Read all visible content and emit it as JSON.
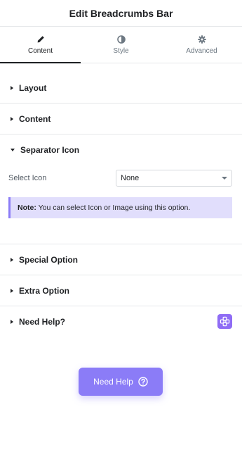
{
  "header": {
    "title": "Edit Breadcrumbs Bar"
  },
  "tabs": [
    {
      "label": "Content",
      "icon": "pencil-icon",
      "active": true
    },
    {
      "label": "Style",
      "icon": "contrast-icon",
      "active": false
    },
    {
      "label": "Advanced",
      "icon": "gear-icon",
      "active": false
    }
  ],
  "sections": {
    "layout": {
      "title": "Layout"
    },
    "content": {
      "title": "Content"
    },
    "separator": {
      "title": "Separator Icon",
      "select_label": "Select Icon",
      "select_value": "None",
      "note_bold": "Note:",
      "note_text": " You can select Icon or Image using this option."
    },
    "special": {
      "title": "Special Option"
    },
    "extra": {
      "title": "Extra Option"
    },
    "help": {
      "title": "Need Help?",
      "badge_icon": "plugin-logo-icon"
    }
  },
  "need_help_button": {
    "label": "Need Help",
    "icon": "question-circle-icon"
  },
  "colors": {
    "accent": "#8b7cf7",
    "note_bg": "#e1defc",
    "badge": "#8f6cf5"
  }
}
